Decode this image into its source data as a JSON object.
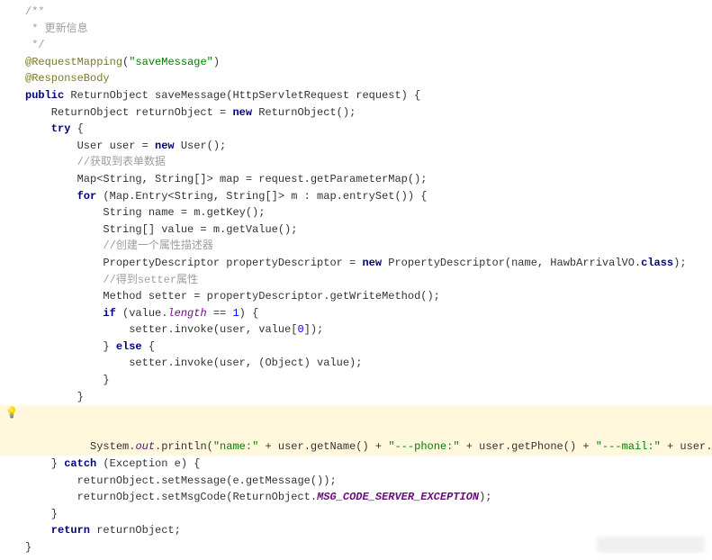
{
  "code": {
    "c1": "/**",
    "c2": " * 更新信息",
    "c3": " */",
    "anno1_a": "@RequestMapping",
    "anno1_b": "(",
    "anno1_c": "\"saveMessage\"",
    "anno1_d": ")",
    "anno2": "@ResponseBody",
    "sig_kw": "public",
    "sig_rest": " ReturnObject saveMessage(HttpServletRequest request) {",
    "l1a": "    ReturnObject returnObject = ",
    "l1_new": "new",
    "l1b": " ReturnObject();",
    "try_kw": "    try",
    "try_brace": " {",
    "l2a": "        User user = ",
    "l2_new": "new",
    "l2b": " User();",
    "l3": "        //获取到表单数据",
    "l4": "        Map<String, String[]> map = request.getParameterMap();",
    "l5_for": "        for",
    "l5_rest": " (Map.Entry<String, String[]> m : map.entrySet()) {",
    "l6": "            String name = m.getKey();",
    "l7": "            String[] value = m.getValue();",
    "l8": "            //创建一个属性描述器",
    "l9a": "            PropertyDescriptor propertyDescriptor = ",
    "l9_new": "new",
    "l9b": " PropertyDescriptor(name, HawbArrivalVO.",
    "l9_class": "class",
    "l9c": ");",
    "l10a": "            //得到",
    "l10b": "setter",
    "l10c": "属性",
    "l11": "            Method setter = propertyDescriptor.getWriteMethod();",
    "l12_if": "            if",
    "l12a": " (value.",
    "l12_len": "length",
    "l12b": " == ",
    "l12_num": "1",
    "l12c": ") {",
    "l13a": "                setter.invoke(user, value[",
    "l13_num": "0",
    "l13b": "]);",
    "l14a": "            } ",
    "l14_else": "else",
    "l14b": " {",
    "l15": "                setter.invoke(user, (Object) value);",
    "l16": "            }",
    "l17": "        }",
    "l18a": "        System.",
    "l18_out": "out",
    "l18b": ".println(",
    "l18_s1": "\"name:\"",
    "l18c": " + user.getName() + ",
    "l18_s2": "\"---phone:\"",
    "l18d": " + user.getPhone() + ",
    "l18_s3": "\"---mail:\"",
    "l18e": " + user.getMail",
    "l18_p1": "(",
    "l18_p2": ")",
    "l18f": ");",
    "l19a": "    } ",
    "l19_catch": "catch",
    "l19b": " (Exception e) {",
    "l20": "        returnObject.setMessage(e.getMessage());",
    "l21a": "        returnObject.setMsgCode(ReturnObject.",
    "l21_const": "MSG_CODE_SERVER_EXCEPTION",
    "l21b": ");",
    "l22": "    }",
    "l23_ret": "    return",
    "l23b": " returnObject;",
    "l24": "}"
  }
}
